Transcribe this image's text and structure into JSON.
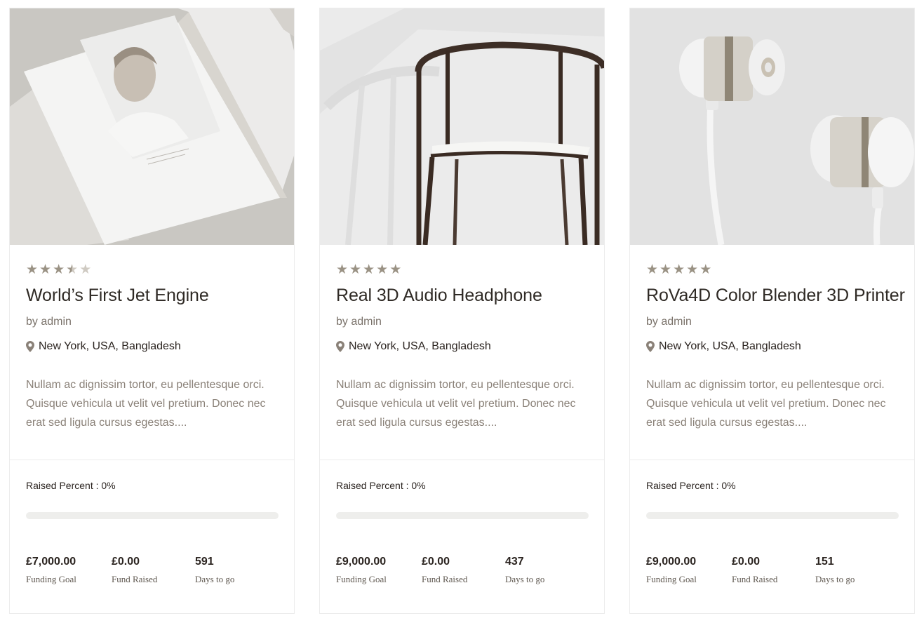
{
  "colors": {
    "accent": "#9a9284",
    "title": "#2f2a25",
    "muted_text": "#8a8178",
    "border": "#ececec",
    "progress_track": "#eeeeec"
  },
  "cards": [
    {
      "image_subject": "magazine-photo",
      "rating": 3.5,
      "title": "World’s First Jet Engine",
      "author": "by admin",
      "location": "New York, USA, Bangladesh",
      "description": "Nullam ac dignissim tortor, eu pellentesque orci. Quisque vehicula ut velit vel pretium. Donec nec erat sed ligula cursus egestas....",
      "raised_label": "Raised Percent : 0%",
      "raised_fraction": 0,
      "funding_goal": "£7,000.00",
      "funding_goal_label": "Funding Goal",
      "fund_raised": "£0.00",
      "fund_raised_label": "Fund Raised",
      "days_to_go": "591",
      "days_to_go_label": "Days to go"
    },
    {
      "image_subject": "wooden-chair-photo",
      "rating": 5,
      "title": "Real 3D Audio Headphone",
      "author": "by admin",
      "location": "New York, USA, Bangladesh",
      "description": "Nullam ac dignissim tortor, eu pellentesque orci. Quisque vehicula ut velit vel pretium. Donec nec erat sed ligula cursus egestas....",
      "raised_label": "Raised Percent : 0%",
      "raised_fraction": 0,
      "funding_goal": "£9,000.00",
      "funding_goal_label": "Funding Goal",
      "fund_raised": "£0.00",
      "fund_raised_label": "Fund Raised",
      "days_to_go": "437",
      "days_to_go_label": "Days to go"
    },
    {
      "image_subject": "earphones-photo",
      "rating": 5,
      "title": "RoVa4D Color Blender 3D Printer",
      "author": "by admin",
      "location": "New York, USA, Bangladesh",
      "description": "Nullam ac dignissim tortor, eu pellentesque orci. Quisque vehicula ut velit vel pretium. Donec nec erat sed ligula cursus egestas....",
      "raised_label": "Raised Percent : 0%",
      "raised_fraction": 0,
      "funding_goal": "£9,000.00",
      "funding_goal_label": "Funding Goal",
      "fund_raised": "£0.00",
      "fund_raised_label": "Fund Raised",
      "days_to_go": "151",
      "days_to_go_label": "Days to go"
    }
  ]
}
